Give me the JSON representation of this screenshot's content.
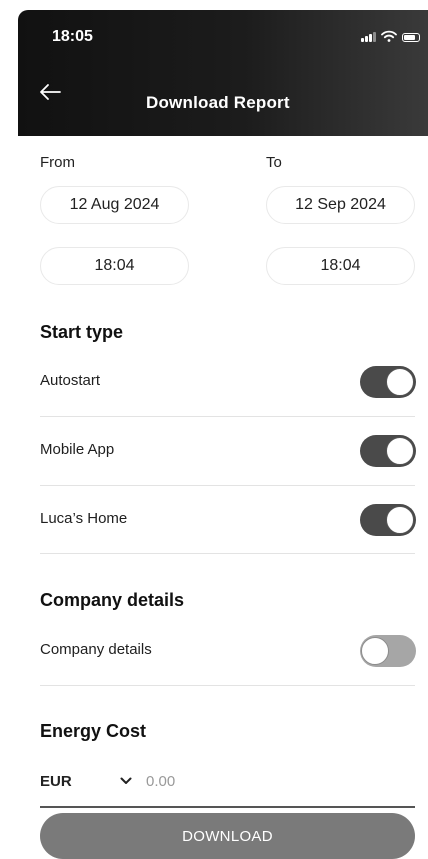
{
  "status_bar": {
    "time": "18:05"
  },
  "header": {
    "title": "Download Report"
  },
  "range": {
    "from_label": "From",
    "to_label": "To",
    "from_date": "12 Aug 2024",
    "to_date": "12 Sep 2024",
    "from_time": "18:04",
    "to_time": "18:04"
  },
  "start_type": {
    "title": "Start type",
    "items": [
      {
        "label": "Autostart",
        "enabled": true
      },
      {
        "label": "Mobile App",
        "enabled": true
      },
      {
        "label": "Luca’s Home",
        "enabled": true
      }
    ]
  },
  "company": {
    "title": "Company details",
    "toggle_label": "Company details",
    "enabled": false
  },
  "energy_cost": {
    "title": "Energy Cost",
    "currency": "EUR",
    "amount_placeholder": "0.00"
  },
  "download_label": "DOWNLOAD",
  "colors": {
    "header_bg": "#111111",
    "toggle_on": "#4a4a4a",
    "toggle_off": "#a6a6a6",
    "button": "#7a7a7a"
  }
}
